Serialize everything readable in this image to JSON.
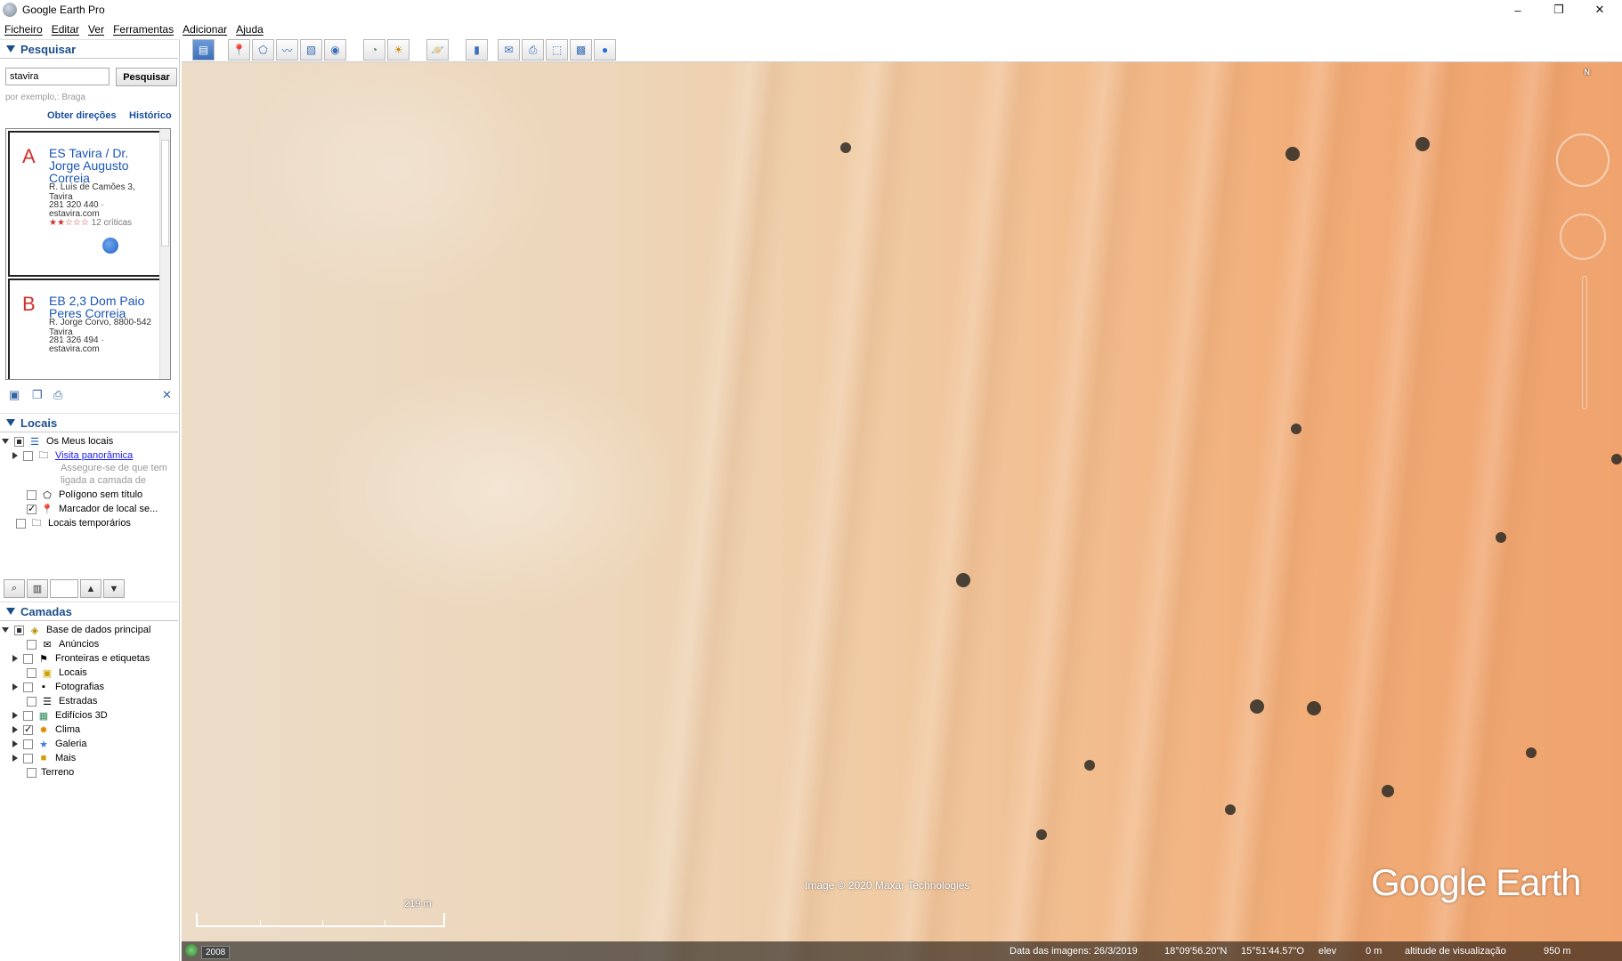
{
  "window": {
    "title": "Google Earth Pro",
    "minimize": "–",
    "restore": "❐",
    "close": "✕"
  },
  "menu": [
    "Ficheiro",
    "Editar",
    "Ver",
    "Ferramentas",
    "Adicionar",
    "Ajuda"
  ],
  "search": {
    "header": "Pesquisar",
    "input_value": "stavira",
    "button": "Pesquisar",
    "hint": "por exemplo,: Braga",
    "directions": "Obter direções",
    "history": "Histórico",
    "results": [
      {
        "letter": "A",
        "name": "ES Tavira / Dr. Jorge Augusto Correia",
        "address": "R. Luís de Camões 3, Tavira",
        "phone": "281 320 440 ·",
        "site": "estavira.com",
        "stars": "★★☆☆☆",
        "reviews": "12 críticas"
      },
      {
        "letter": "B",
        "name": "EB 2,3 Dom Paio Peres Correia",
        "address": "R. Jorge Corvo, 8800-542 Tavira",
        "phone": "281 326 494 ·",
        "site": "estavira.com"
      }
    ]
  },
  "places": {
    "header": "Locais",
    "items": [
      {
        "label": "Os Meus locais"
      },
      {
        "label": "Visita panorâmica"
      },
      {
        "label": "Assegure-se de que tem"
      },
      {
        "label": "ligada a camada de"
      },
      {
        "label": "Polígono sem título"
      },
      {
        "label": "Marcador de local se..."
      },
      {
        "label": "Locais temporários"
      }
    ]
  },
  "layers": {
    "header": "Camadas",
    "items": [
      {
        "label": "Base de dados principal"
      },
      {
        "label": "Anúncios"
      },
      {
        "label": "Fronteiras e etiquetas"
      },
      {
        "label": "Locais"
      },
      {
        "label": "Fotografias"
      },
      {
        "label": "Estradas"
      },
      {
        "label": "Edifícios 3D"
      },
      {
        "label": "Clima"
      },
      {
        "label": "Galeria"
      },
      {
        "label": "Mais"
      },
      {
        "label": "Terreno"
      }
    ]
  },
  "map": {
    "attribution": "Image © 2020 Maxar Technologies",
    "logo": "Google Earth",
    "scale": "219 m",
    "north": "N"
  },
  "status": {
    "year": "2008",
    "imagery_date": "Data das imagens: 26/3/2019",
    "lat": "18°09'56.20\"N",
    "lon": "15°51'44.57\"O",
    "elev_label": "elev",
    "elev_value": "0 m",
    "eye_label": "altitude de visualização",
    "eye_value": "950 m"
  }
}
